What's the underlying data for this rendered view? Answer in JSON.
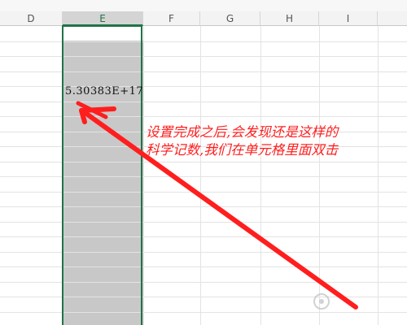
{
  "columns": [
    {
      "id": "col-d",
      "label": "D"
    },
    {
      "id": "col-e",
      "label": "E"
    },
    {
      "id": "col-f",
      "label": "F"
    },
    {
      "id": "col-g",
      "label": "G"
    },
    {
      "id": "col-h",
      "label": "H"
    },
    {
      "id": "col-i",
      "label": "I"
    }
  ],
  "selected_column": "E",
  "cell": {
    "value": "5.30383E+17"
  },
  "annotation": {
    "line1": "设置完成之后,会发现还是这样的",
    "line2": "科学记数,我们在单元格里面双击"
  },
  "colors": {
    "grid": "#e3e3e3",
    "selection_fill": "#c8c8c8",
    "selection_border": "#217346",
    "annotation": "#ff1e1e"
  },
  "icons": {
    "arrow": "red-arrow-icon",
    "watermark": "baidu-jingyan-watermark-icon"
  }
}
